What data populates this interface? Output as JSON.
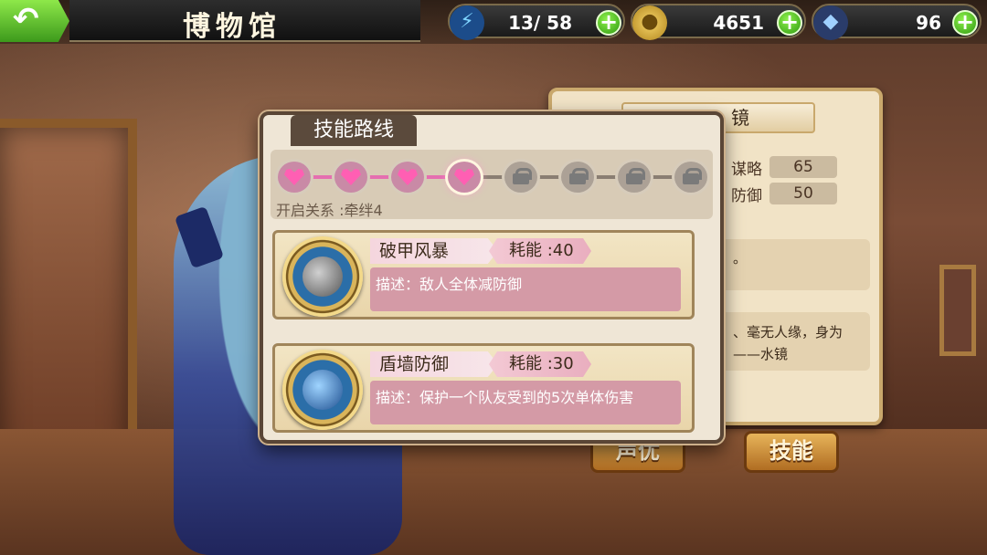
{
  "topbar": {
    "back_glyph": "↶",
    "title": "博物馆",
    "energy": {
      "icon": "lightning-icon",
      "value": "13/ 58"
    },
    "gold": {
      "icon": "coin-icon",
      "value": "4651"
    },
    "gems": {
      "icon": "crystal-icon",
      "value": "96"
    },
    "plus_glyph": "+"
  },
  "info_panel": {
    "name": "镜",
    "stats": [
      {
        "label": "谋略",
        "value": "65"
      },
      {
        "label": "防御",
        "value": "50"
      }
    ],
    "box1_text": "。",
    "bio_line1": "、毫无人缘，身为",
    "bio_line2": "——水镜",
    "buttons": {
      "voice": "声优",
      "skill": "技能"
    }
  },
  "dialog": {
    "tab_title": "技能路线",
    "route": {
      "hearts_total": 8,
      "hearts_unlocked": 4,
      "condition": "开启关系 :牵绊4"
    },
    "skills": [
      {
        "name": "破甲风暴",
        "cost": "耗能 :40",
        "desc_prefix": "描述：",
        "desc": "敌人全体减防御",
        "icon": "sword-armor-icon"
      },
      {
        "name": "盾墙防御",
        "cost": "耗能 :30",
        "desc_prefix": "描述：",
        "desc": "保护一个队友受到的5次单体伤害",
        "icon": "shield-icon"
      }
    ]
  },
  "colors": {
    "accent_green": "#3d9a1c",
    "heart_pink": "#ff5fb3",
    "desc_pink": "#d49aa6"
  }
}
